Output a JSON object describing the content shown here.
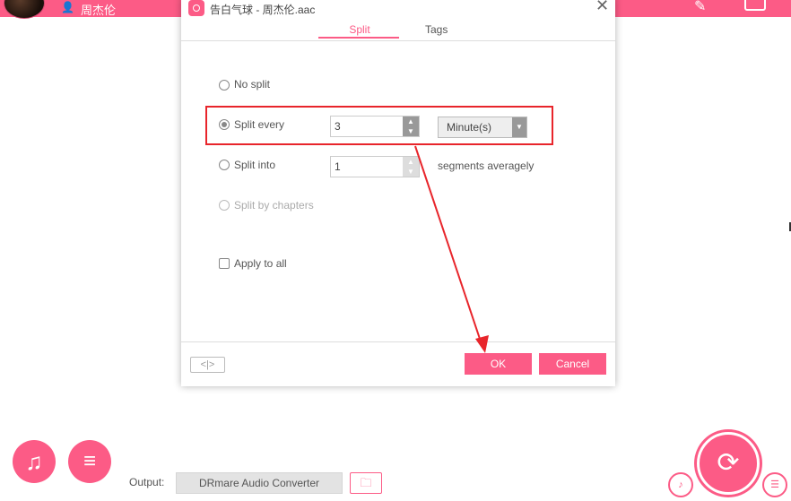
{
  "header": {
    "artist_icon": "user-icon",
    "artist_name": "周杰伦",
    "edit_icon": "pencil-icon",
    "window_icon": "window-icon"
  },
  "dialog": {
    "title": "告白气球 - 周杰伦.aac",
    "close_label": "✕",
    "tabs": [
      {
        "label": "Split",
        "active": true
      },
      {
        "label": "Tags",
        "active": false
      }
    ],
    "options": {
      "no_split": "No split",
      "split_every": "Split every",
      "split_into": "Split into",
      "split_by_chapters": "Split by chapters",
      "apply_to_all": "Apply to all"
    },
    "selected_option": "Split every",
    "split_every_value": "3",
    "split_every_unit": "Minute(s)",
    "split_into_value": "1",
    "segments_label": "segments averagely",
    "nav_label": "<|>",
    "ok_label": "OK",
    "cancel_label": "Cancel"
  },
  "bottom": {
    "add_music_icon": "add-music-icon",
    "add_playlist_icon": "add-playlist-icon",
    "output_label": "Output:",
    "output_path": "DRmare Audio Converter",
    "folder_icon": "folder-icon",
    "convert_icon": "convert-icon",
    "file_audio_icon": "file-audio-icon",
    "list_check_icon": "list-check-icon"
  },
  "colors": {
    "accent": "#fc5b86",
    "annotation": "#e8252b"
  }
}
